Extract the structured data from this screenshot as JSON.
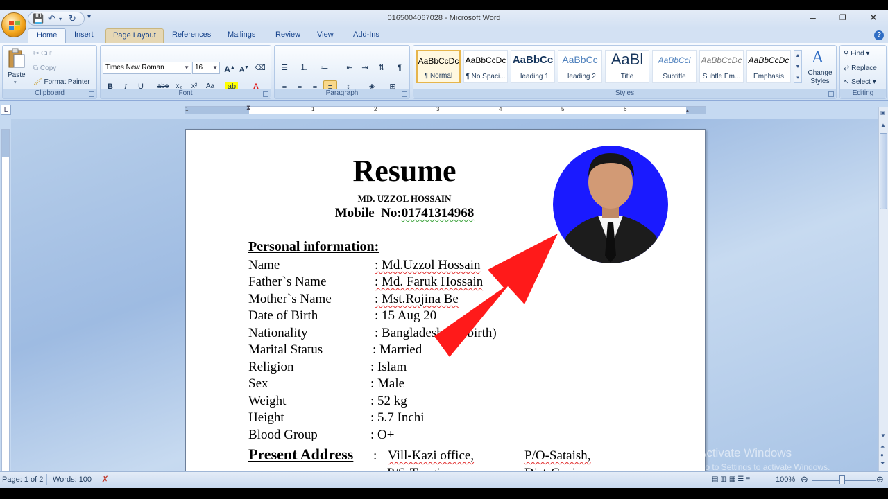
{
  "window": {
    "title": "0165004067028 - Microsoft Word",
    "office_icon": "office-logo-icon",
    "controls": [
      "minimize-icon",
      "restore-icon",
      "close-icon"
    ]
  },
  "tabs": [
    "Home",
    "Insert",
    "Page Layout",
    "References",
    "Mailings",
    "Review",
    "View",
    "Add-Ins"
  ],
  "ribbon": {
    "clipboard": {
      "label": "Clipboard",
      "paste": "Paste",
      "cut": "Cut",
      "copy": "Copy",
      "format_painter": "Format Painter"
    },
    "font": {
      "label": "Font",
      "family": "Times New Roman",
      "size": "16",
      "bold": "B",
      "italic": "I",
      "underline": "U",
      "strike": "abe",
      "subscript": "x₂",
      "superscript": "x²",
      "case": "Aa"
    },
    "paragraph": {
      "label": "Paragraph"
    },
    "styles": {
      "label": "Styles",
      "items": [
        {
          "preview": "AaBbCcDc",
          "name": "¶ Normal"
        },
        {
          "preview": "AaBbCcDc",
          "name": "¶ No Spaci..."
        },
        {
          "preview": "AaBbCc",
          "name": "Heading 1"
        },
        {
          "preview": "AaBbCc",
          "name": "Heading 2"
        },
        {
          "preview": "AaBl",
          "name": "Title"
        },
        {
          "preview": "AaBbCcl",
          "name": "Subtitle"
        },
        {
          "preview": "AaBbCcDc",
          "name": "Subtle Em..."
        },
        {
          "preview": "AaBbCcDc",
          "name": "Emphasis"
        }
      ],
      "change_styles": "Change Styles"
    },
    "editing": {
      "label": "Editing",
      "find": "Find",
      "replace": "Replace",
      "select": "Select"
    }
  },
  "ruler_numbers": [
    "1",
    "1",
    "2",
    "3",
    "4",
    "5",
    "6"
  ],
  "document": {
    "title": "Resume",
    "name": "MD. UZZOL HOSSAIN",
    "mobile_label": "Mobile  No:",
    "mobile_number": "01741314968",
    "section_personal": "Personal information:",
    "rows": [
      {
        "label": "Name",
        "value": ": Md.Uzzol Hossain"
      },
      {
        "label": "Father`s Name",
        "value": ": Md. Faruk Hossain"
      },
      {
        "label": "Mother`s Name",
        "value": ": Mst.Rojina Be"
      },
      {
        "label": "Date of Birth",
        "value": ": 15 Aug 20"
      },
      {
        "label": "Nationality",
        "value": ": Bangladesh (by birth)"
      },
      {
        "label": "Marital Status",
        "value": ": Married"
      },
      {
        "label": "Religion",
        "value": ": Islam"
      },
      {
        "label": "Sex",
        "value": ": Male"
      },
      {
        "label": "Weight",
        "value": ": 52 kg"
      },
      {
        "label": "Height",
        "value": ": 5.7 Inchi"
      },
      {
        "label": "Blood Group",
        "value": ": O+"
      }
    ],
    "section_address": "Present Address",
    "address_colon": ":",
    "address_1": "Vill-Kazi office,",
    "address_2": "P/O-Sataish,",
    "address_3": "P/S-Tongi",
    "address_4": "Dist-Gazip"
  },
  "watermark": {
    "line1": "Activate Windows",
    "line2": "Go to Settings to activate Windows."
  },
  "status": {
    "page": "Page: 1 of 2",
    "words": "Words: 100",
    "zoom": "100%"
  },
  "colors": {
    "photo_bg": "#1a1aff",
    "arrow": "#ff1a1a",
    "accent": "#15428b"
  }
}
